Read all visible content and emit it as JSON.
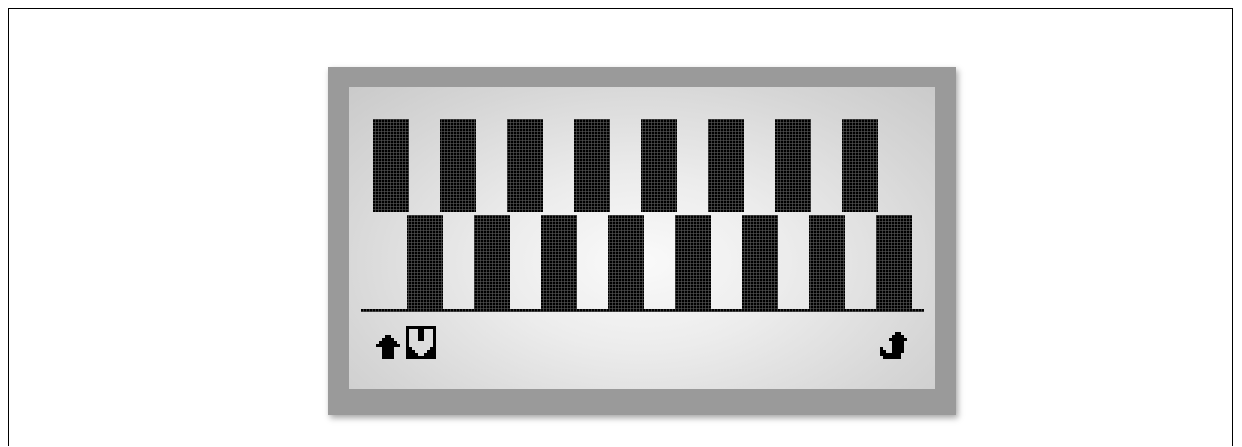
{
  "device": {
    "screen_title": "",
    "colors": {
      "bezel": "#9a9a9a",
      "lcd_background": "#e6e6e6",
      "pixel_on": "#000000"
    }
  },
  "channels": {
    "count": 16,
    "levels": [
      1,
      1,
      1,
      1,
      1,
      1,
      1,
      1,
      1,
      1,
      1,
      1,
      1,
      1,
      1,
      1
    ],
    "row_top_count": 8,
    "row_bottom_count": 8
  },
  "softkeys": {
    "left_up": {
      "icon": "arrow-up-icon",
      "selected": false
    },
    "left_down": {
      "icon": "arrow-down-icon",
      "selected": true
    },
    "right_enter": {
      "icon": "return-icon",
      "selected": false
    }
  }
}
